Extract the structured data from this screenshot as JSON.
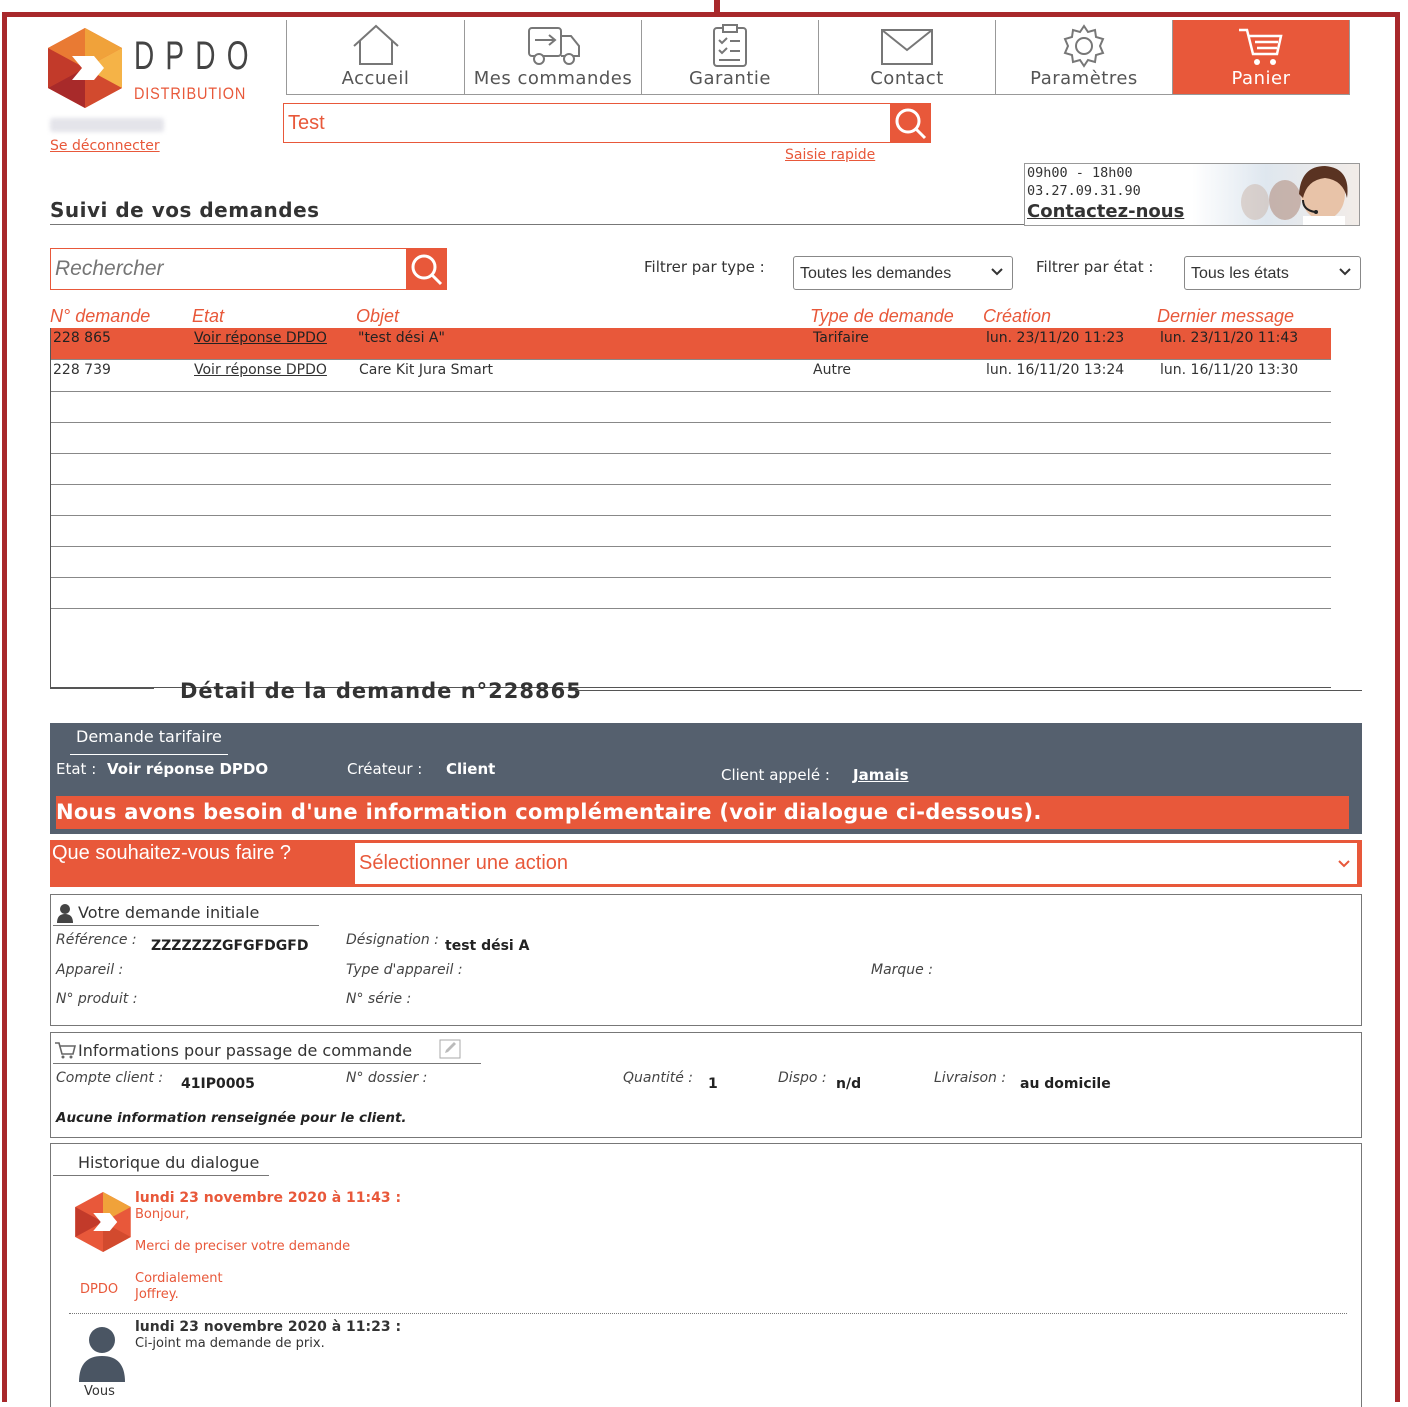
{
  "brand": {
    "name": "DPDO",
    "sub": "DISTRIBUTION",
    "orange": "#e8583a",
    "dark_red": "#a8282b",
    "slate": "#55606e"
  },
  "user": {
    "logout": "Se déconnecter"
  },
  "nav": [
    {
      "label": "Accueil",
      "icon": "home-icon"
    },
    {
      "label": "Mes commandes",
      "icon": "truck-icon"
    },
    {
      "label": "Garantie",
      "icon": "clipboard-icon"
    },
    {
      "label": "Contact",
      "icon": "envelope-icon"
    },
    {
      "label": "Paramètres",
      "icon": "gear-icon"
    },
    {
      "label": "Panier",
      "icon": "cart-icon",
      "active": true
    }
  ],
  "quick_search": {
    "value": "Test",
    "link": "Saisie rapide"
  },
  "contact": {
    "hours": "09h00 - 18h00",
    "phone": "03.27.09.31.90",
    "link": "Contactez-nous"
  },
  "page_title": "Suivi de vos demandes",
  "search": {
    "placeholder": "Rechercher"
  },
  "filters": {
    "type_label": "Filtrer par type :",
    "type_value": "Toutes les demandes",
    "state_label": "Filtrer par état :",
    "state_value": "Tous les états"
  },
  "table": {
    "headers": [
      "N° demande",
      "Etat",
      "Objet",
      "Type de demande",
      "Création",
      "Dernier message"
    ],
    "rows": [
      {
        "num": "228 865",
        "etat": "Voir réponse DPDO",
        "objet": "\"test dési A\"",
        "type": "Tarifaire",
        "creation": "lun. 23/11/20 11:23",
        "dernier": "lun. 23/11/20 11:43",
        "selected": true
      },
      {
        "num": "228 739",
        "etat": "Voir réponse DPDO",
        "objet": "Care Kit Jura Smart",
        "type": "Autre",
        "creation": "lun. 16/11/20 13:24",
        "dernier": "lun. 16/11/20 13:30"
      }
    ]
  },
  "detail": {
    "title": "Détail de la demande n°228865",
    "tab": "Demande tarifaire",
    "etat_label": "Etat :",
    "etat_value": "Voir réponse DPDO",
    "createur_label": "Créateur :",
    "createur_value": "Client",
    "appele_label": "Client appelé :",
    "appele_value": "Jamais",
    "alert": "Nous avons besoin d'une information complémentaire (voir dialogue ci-dessous).",
    "question": "Que souhaitez-vous faire ?",
    "action_placeholder": "Sélectionner une action"
  },
  "initial": {
    "title": "Votre demande initiale",
    "ref_label": "Référence :",
    "ref_value": "ZZZZZZZGFGFDGFD",
    "desig_label": "Désignation :",
    "desig_value": "test dési A",
    "appareil_label": "Appareil :",
    "type_label": "Type d'appareil :",
    "marque_label": "Marque :",
    "produit_label": "N° produit :",
    "serie_label": "N° série :"
  },
  "order_info": {
    "title": "Informations pour passage de commande",
    "compte_label": "Compte client :",
    "compte_value": "41IP0005",
    "dossier_label": "N° dossier :",
    "qte_label": "Quantité :",
    "qte_value": "1",
    "dispo_label": "Dispo :",
    "dispo_value": "n/d",
    "livraison_label": "Livraison :",
    "livraison_value": "au domicile",
    "note": "Aucune information renseignée pour le client."
  },
  "history": {
    "title": "Historique du dialogue",
    "messages": [
      {
        "author": "DPDO",
        "date": "lundi 23 novembre 2020 à 11:43 :",
        "l1": "Bonjour,",
        "l2": "Merci de preciser votre demande",
        "l3": "Cordialement",
        "l4": "Joffrey."
      },
      {
        "author": "Vous",
        "date": "lundi 23 novembre 2020 à 11:23 :",
        "l1": "Ci-joint ma demande de prix."
      }
    ]
  }
}
